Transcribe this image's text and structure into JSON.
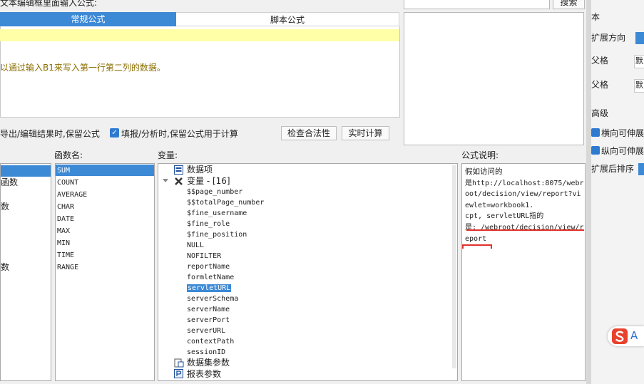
{
  "top": {
    "label": "文本编辑框里面输入公式:",
    "search_button": "搜索"
  },
  "tabs": [
    {
      "label": "常规公式"
    },
    {
      "label": "脚本公式"
    }
  ],
  "editor": {
    "hint": "以通过输入B1来写入第一行第二列的数据。"
  },
  "options": {
    "export_keep": "导出/编辑结果时,保留公式",
    "fill_keep": "填报/分析时,保留公式用于计算",
    "fill_checked": true,
    "check_button": "检查合法性",
    "calc_button": "实时计算"
  },
  "headers": {
    "function_name": "函数名:",
    "variables": "变量:",
    "description": "公式说明:"
  },
  "categories": [
    "",
    "函数",
    "数",
    "",
    "",
    "",
    "",
    "数"
  ],
  "functions": [
    "SUM",
    "COUNT",
    "AVERAGE",
    "CHAR",
    "DATE",
    "MAX",
    "MIN",
    "TIME",
    "RANGE"
  ],
  "variables": {
    "data_items": "数据项",
    "var_group": "变量 - [16]",
    "items": [
      "$$page_number",
      "$$totalPage_number",
      "$fine_username",
      "$fine_role",
      "$fine_position",
      "NULL",
      "NOFILTER",
      "reportName",
      "formletName",
      "servletURL",
      "serverSchema",
      "serverName",
      "serverPort",
      "serverURL",
      "contextPath",
      "sessionID"
    ],
    "selected": "servletURL",
    "dataset_params": "数据集参数",
    "report_params": "报表参数"
  },
  "description": {
    "line1": "假如访问的",
    "line2": "是http://localhost:8075/webroot/decision/view/report?viewlet=workbook1.",
    "line3": "cpt, servletURL指的",
    "line4": "是: /webroot/decision/view/report"
  },
  "right_panel": {
    "header": "本",
    "expand_direction": "扩展方向",
    "parent1": "父格",
    "parent2": "父格",
    "box_text": "默",
    "advanced": "高级",
    "horizontal": "横向可伸展",
    "vertical": "纵向可伸展",
    "sort_after": "扩展后排序",
    "ime_letter": "A"
  },
  "colors": {
    "accent": "#3c89d6",
    "highlight": "#ffffa8",
    "underline": "#e0302a",
    "brand_red": "#e8412c"
  }
}
